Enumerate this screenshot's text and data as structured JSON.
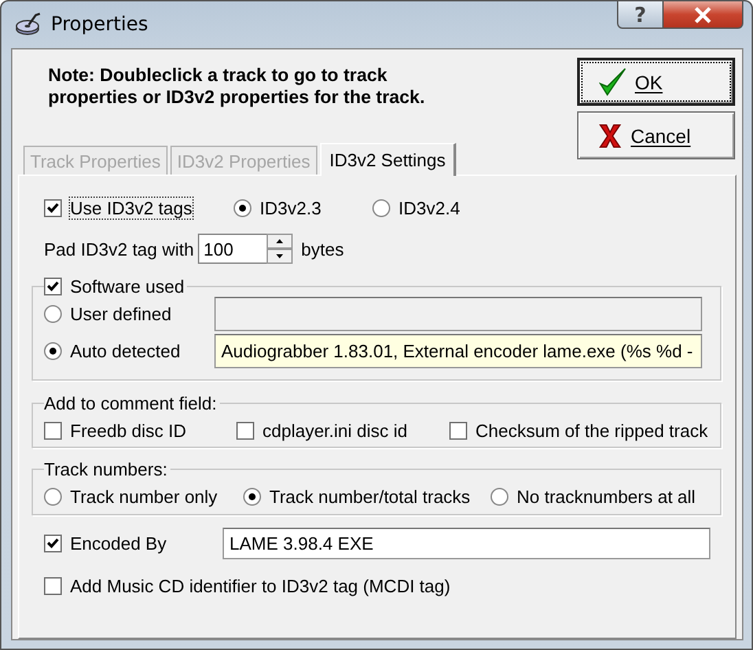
{
  "window": {
    "title": "Properties",
    "help_button": "?"
  },
  "note": "Note: Doubleclick a track to go to track properties or ID3v2 properties for the track.",
  "buttons": [
    {
      "label": "OK",
      "kind": "ok",
      "focused": true
    },
    {
      "label": "Cancel",
      "kind": "cancel",
      "focused": false
    }
  ],
  "tabs": [
    {
      "label": "Track Properties",
      "selected": false,
      "disabled": true
    },
    {
      "label": "ID3v2 Properties",
      "selected": false,
      "disabled": true
    },
    {
      "label": "ID3v2 Settings",
      "selected": true,
      "disabled": false
    }
  ],
  "use_id3v2": {
    "label": "Use ID3v2 tags",
    "checked": true
  },
  "versions": [
    {
      "label": "ID3v2.3",
      "selected": true
    },
    {
      "label": "ID3v2.4",
      "selected": false
    }
  ],
  "padding": {
    "label": "Pad ID3v2 tag with",
    "value": "100",
    "unit": "bytes"
  },
  "software_used": {
    "label": "Software used",
    "checked": true,
    "options": [
      {
        "label": "User defined",
        "selected": false
      },
      {
        "label": "Auto detected",
        "selected": true,
        "value": "Audiograbber 1.83.01, External encoder lame.exe (%s %d -"
      }
    ]
  },
  "comment_field": {
    "title": "Add to comment field:",
    "options": [
      {
        "label": "Freedb disc ID",
        "checked": false
      },
      {
        "label": "cdplayer.ini disc id",
        "checked": false
      },
      {
        "label": "Checksum of the ripped track",
        "checked": false
      }
    ]
  },
  "track_numbers": {
    "title": "Track numbers:",
    "options": [
      {
        "label": "Track number only",
        "selected": false
      },
      {
        "label": "Track number/total tracks",
        "selected": true
      },
      {
        "label": "No tracknumbers at all",
        "selected": false
      }
    ]
  },
  "encoded_by": {
    "label": "Encoded By",
    "checked": true,
    "value": "LAME 3.98.4 EXE"
  },
  "mcdi": {
    "label": "Add Music CD identifier to ID3v2 tag (MCDI tag)",
    "checked": false
  }
}
